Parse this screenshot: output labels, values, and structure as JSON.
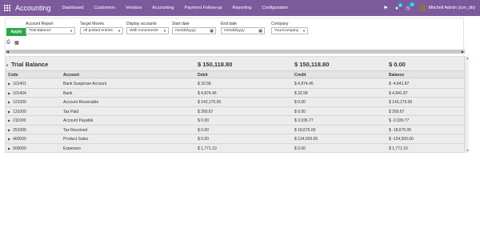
{
  "navbar": {
    "brand": "Accounting",
    "menu": [
      "Dashboard",
      "Customers",
      "Vendors",
      "Accounting",
      "Payment Follow-up",
      "Reporting",
      "Configuration"
    ],
    "chat_badge": "6",
    "activity_badge": "2",
    "user_name": "Mitchell Admin (icm_db)"
  },
  "filters": {
    "apply_label": "Apply",
    "account_report": {
      "label": "Account Report",
      "value": "Trial Balance"
    },
    "target_moves": {
      "label": "Target Moves",
      "value": "All posted entries"
    },
    "display_accounts": {
      "label": "Display accounts",
      "value": "With movements"
    },
    "start_date": {
      "label": "Start date",
      "placeholder": "mm/dd/yyyy"
    },
    "end_date": {
      "label": "End date",
      "placeholder": "mm/dd/yyyy"
    },
    "company": {
      "label": "Company",
      "value": "YourCompany"
    }
  },
  "report": {
    "title": "Trial Balance",
    "total_debit": "$ 150,118.80",
    "total_credit": "$ 150,118.80",
    "total_balance": "$ 0.00",
    "headers": {
      "code": "Code",
      "account": "Account",
      "debit": "Debit",
      "credit": "Credit",
      "balance": "Balance"
    },
    "rows": [
      {
        "code": "101401",
        "account": "Bank Suspense Account",
        "debit": "$ 32.58",
        "credit": "$ 4,874.45",
        "balance": "$ -4,841.87"
      },
      {
        "code": "101404",
        "account": "Bank",
        "debit": "$ 4,874.45",
        "credit": "$ 32.58",
        "balance": "$ 4,841.87"
      },
      {
        "code": "121000",
        "account": "Account Receivable",
        "debit": "$ 143,175.00",
        "credit": "$ 0.00",
        "balance": "$ 143,175.00"
      },
      {
        "code": "131000",
        "account": "Tax Paid",
        "debit": "$ 265.67",
        "credit": "$ 0.00",
        "balance": "$ 265.67"
      },
      {
        "code": "211000",
        "account": "Account Payable",
        "debit": "$ 0.00",
        "credit": "$ 2,036.77",
        "balance": "$ -2,036.77"
      },
      {
        "code": "251000",
        "account": "Tax Received",
        "debit": "$ 0.00",
        "credit": "$ 18,675.00",
        "balance": "$ -18,675.00"
      },
      {
        "code": "400000",
        "account": "Product Sales",
        "debit": "$ 0.00",
        "credit": "$ 124,500.00",
        "balance": "$ -124,500.00"
      },
      {
        "code": "600000",
        "account": "Expenses",
        "debit": "$ 1,771.10",
        "credit": "$ 0.00",
        "balance": "$ 1,771.10"
      }
    ]
  },
  "colors": {
    "navbar": "#7c5a9c",
    "apply_button": "#28a745"
  },
  "icons": [
    "apps-icon",
    "bug-icon",
    "chat-icon",
    "activity-icon",
    "print-icon",
    "spreadsheet-icon"
  ]
}
